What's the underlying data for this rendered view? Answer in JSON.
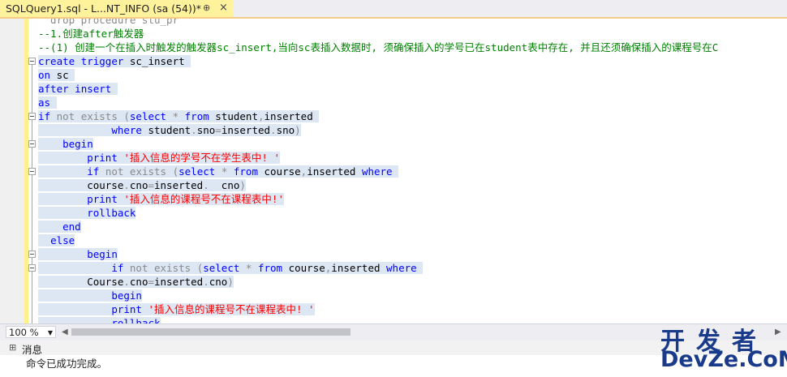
{
  "tab": {
    "title": "SQLQuery1.sql - L...NT_INFO (sa (54))*",
    "pin": "⊕",
    "close": "×"
  },
  "editor": {
    "lines": [
      [
        {
          "t": "  drop procedure stu_pr",
          "c": "gr"
        }
      ],
      [
        {
          "t": "--1.创建after触发器",
          "c": "cm"
        }
      ],
      [
        {
          "t": "--(1) 创建一个在插入时触发的触发器sc_insert,当向sc表插入数据时, 须确保插入的学号已在student表中存在, 并且还须确保插入的课程号在C",
          "c": "cm"
        }
      ],
      [
        {
          "t": "create",
          "c": "kw"
        },
        {
          "t": " ",
          "c": "tx"
        },
        {
          "t": "trigger",
          "c": "kw"
        },
        {
          "t": " sc_insert ",
          "c": "tx"
        }
      ],
      [
        {
          "t": "on",
          "c": "kw"
        },
        {
          "t": " sc ",
          "c": "tx"
        }
      ],
      [
        {
          "t": "after",
          "c": "kw"
        },
        {
          "t": " ",
          "c": "tx"
        },
        {
          "t": "insert",
          "c": "kw"
        },
        {
          "t": " ",
          "c": "tx"
        }
      ],
      [
        {
          "t": "as",
          "c": "kw"
        },
        {
          "t": " ",
          "c": "tx"
        }
      ],
      [
        {
          "t": "if",
          "c": "kw"
        },
        {
          "t": " ",
          "c": "tx"
        },
        {
          "t": "not exists (",
          "c": "gr"
        },
        {
          "t": "select",
          "c": "kw"
        },
        {
          "t": " ",
          "c": "tx"
        },
        {
          "t": "*",
          "c": "gr"
        },
        {
          "t": " ",
          "c": "tx"
        },
        {
          "t": "from",
          "c": "kw"
        },
        {
          "t": " student",
          "c": "tx"
        },
        {
          "t": ",",
          "c": "gr"
        },
        {
          "t": "inserted ",
          "c": "tx"
        }
      ],
      [
        {
          "t": "            ",
          "c": "tx"
        },
        {
          "t": "where",
          "c": "kw"
        },
        {
          "t": " student",
          "c": "tx"
        },
        {
          "t": ".",
          "c": "gr"
        },
        {
          "t": "sno",
          "c": "tx"
        },
        {
          "t": "=",
          "c": "gr"
        },
        {
          "t": "inserted",
          "c": "tx"
        },
        {
          "t": ".",
          "c": "gr"
        },
        {
          "t": "sno",
          "c": "tx"
        },
        {
          "t": ")",
          "c": "gr"
        }
      ],
      [
        {
          "t": "    ",
          "c": "tx"
        },
        {
          "t": "begin",
          "c": "kw"
        }
      ],
      [
        {
          "t": "        ",
          "c": "tx"
        },
        {
          "t": "print",
          "c": "kw"
        },
        {
          "t": " ",
          "c": "tx"
        },
        {
          "t": "'插入信息的学号不在学生表中! '",
          "c": "str"
        }
      ],
      [
        {
          "t": "        ",
          "c": "tx"
        },
        {
          "t": "if",
          "c": "kw"
        },
        {
          "t": " ",
          "c": "tx"
        },
        {
          "t": "not exists (",
          "c": "gr"
        },
        {
          "t": "select",
          "c": "kw"
        },
        {
          "t": " ",
          "c": "tx"
        },
        {
          "t": "*",
          "c": "gr"
        },
        {
          "t": " ",
          "c": "tx"
        },
        {
          "t": "from",
          "c": "kw"
        },
        {
          "t": " course",
          "c": "tx"
        },
        {
          "t": ",",
          "c": "gr"
        },
        {
          "t": "inserted ",
          "c": "tx"
        },
        {
          "t": "where",
          "c": "kw"
        },
        {
          "t": " ",
          "c": "tx"
        }
      ],
      [
        {
          "t": "        course",
          "c": "tx"
        },
        {
          "t": ".",
          "c": "gr"
        },
        {
          "t": "cno",
          "c": "tx"
        },
        {
          "t": "=",
          "c": "gr"
        },
        {
          "t": "inserted",
          "c": "tx"
        },
        {
          "t": ".",
          "c": "gr"
        },
        {
          "t": "  cno",
          "c": "tx"
        },
        {
          "t": ")",
          "c": "gr"
        }
      ],
      [
        {
          "t": "        ",
          "c": "tx"
        },
        {
          "t": "print",
          "c": "kw"
        },
        {
          "t": " ",
          "c": "tx"
        },
        {
          "t": "'插入信息的课程号不在课程表中!'",
          "c": "str"
        }
      ],
      [
        {
          "t": "        ",
          "c": "tx"
        },
        {
          "t": "rollback",
          "c": "kw"
        }
      ],
      [
        {
          "t": "    ",
          "c": "tx"
        },
        {
          "t": "end",
          "c": "kw"
        }
      ],
      [
        {
          "t": "  ",
          "c": "tx"
        },
        {
          "t": "else",
          "c": "kw"
        }
      ],
      [
        {
          "t": "        ",
          "c": "tx"
        },
        {
          "t": "begin",
          "c": "kw"
        }
      ],
      [
        {
          "t": "            ",
          "c": "tx"
        },
        {
          "t": "if",
          "c": "kw"
        },
        {
          "t": " ",
          "c": "tx"
        },
        {
          "t": "not exists (",
          "c": "gr"
        },
        {
          "t": "select",
          "c": "kw"
        },
        {
          "t": " ",
          "c": "tx"
        },
        {
          "t": "*",
          "c": "gr"
        },
        {
          "t": " ",
          "c": "tx"
        },
        {
          "t": "from",
          "c": "kw"
        },
        {
          "t": " course",
          "c": "tx"
        },
        {
          "t": ",",
          "c": "gr"
        },
        {
          "t": "inserted ",
          "c": "tx"
        },
        {
          "t": "where",
          "c": "kw"
        },
        {
          "t": " ",
          "c": "tx"
        }
      ],
      [
        {
          "t": "        Course",
          "c": "tx"
        },
        {
          "t": ".",
          "c": "gr"
        },
        {
          "t": "cno",
          "c": "tx"
        },
        {
          "t": "=",
          "c": "gr"
        },
        {
          "t": "inserted",
          "c": "tx"
        },
        {
          "t": ".",
          "c": "gr"
        },
        {
          "t": "cno",
          "c": "tx"
        },
        {
          "t": ")",
          "c": "gr"
        }
      ],
      [
        {
          "t": "            ",
          "c": "tx"
        },
        {
          "t": "begin",
          "c": "kw"
        }
      ],
      [
        {
          "t": "            ",
          "c": "tx"
        },
        {
          "t": "print",
          "c": "kw"
        },
        {
          "t": " ",
          "c": "tx"
        },
        {
          "t": "'插入信息的课程号不在课程表中! '",
          "c": "str"
        }
      ],
      [
        {
          "t": "            ",
          "c": "tx"
        },
        {
          "t": "rollback",
          "c": "kw"
        }
      ]
    ]
  },
  "statusbar": {
    "zoom": "100 %",
    "zoom_arrow": "▼",
    "scroll_left": "◀",
    "scroll_right": "▶"
  },
  "messages": {
    "icon": "⊞",
    "tab_label": "消息",
    "text": "命令已成功完成。"
  },
  "watermark": {
    "line1": "开发者",
    "line2": "DevZe.CoM"
  }
}
